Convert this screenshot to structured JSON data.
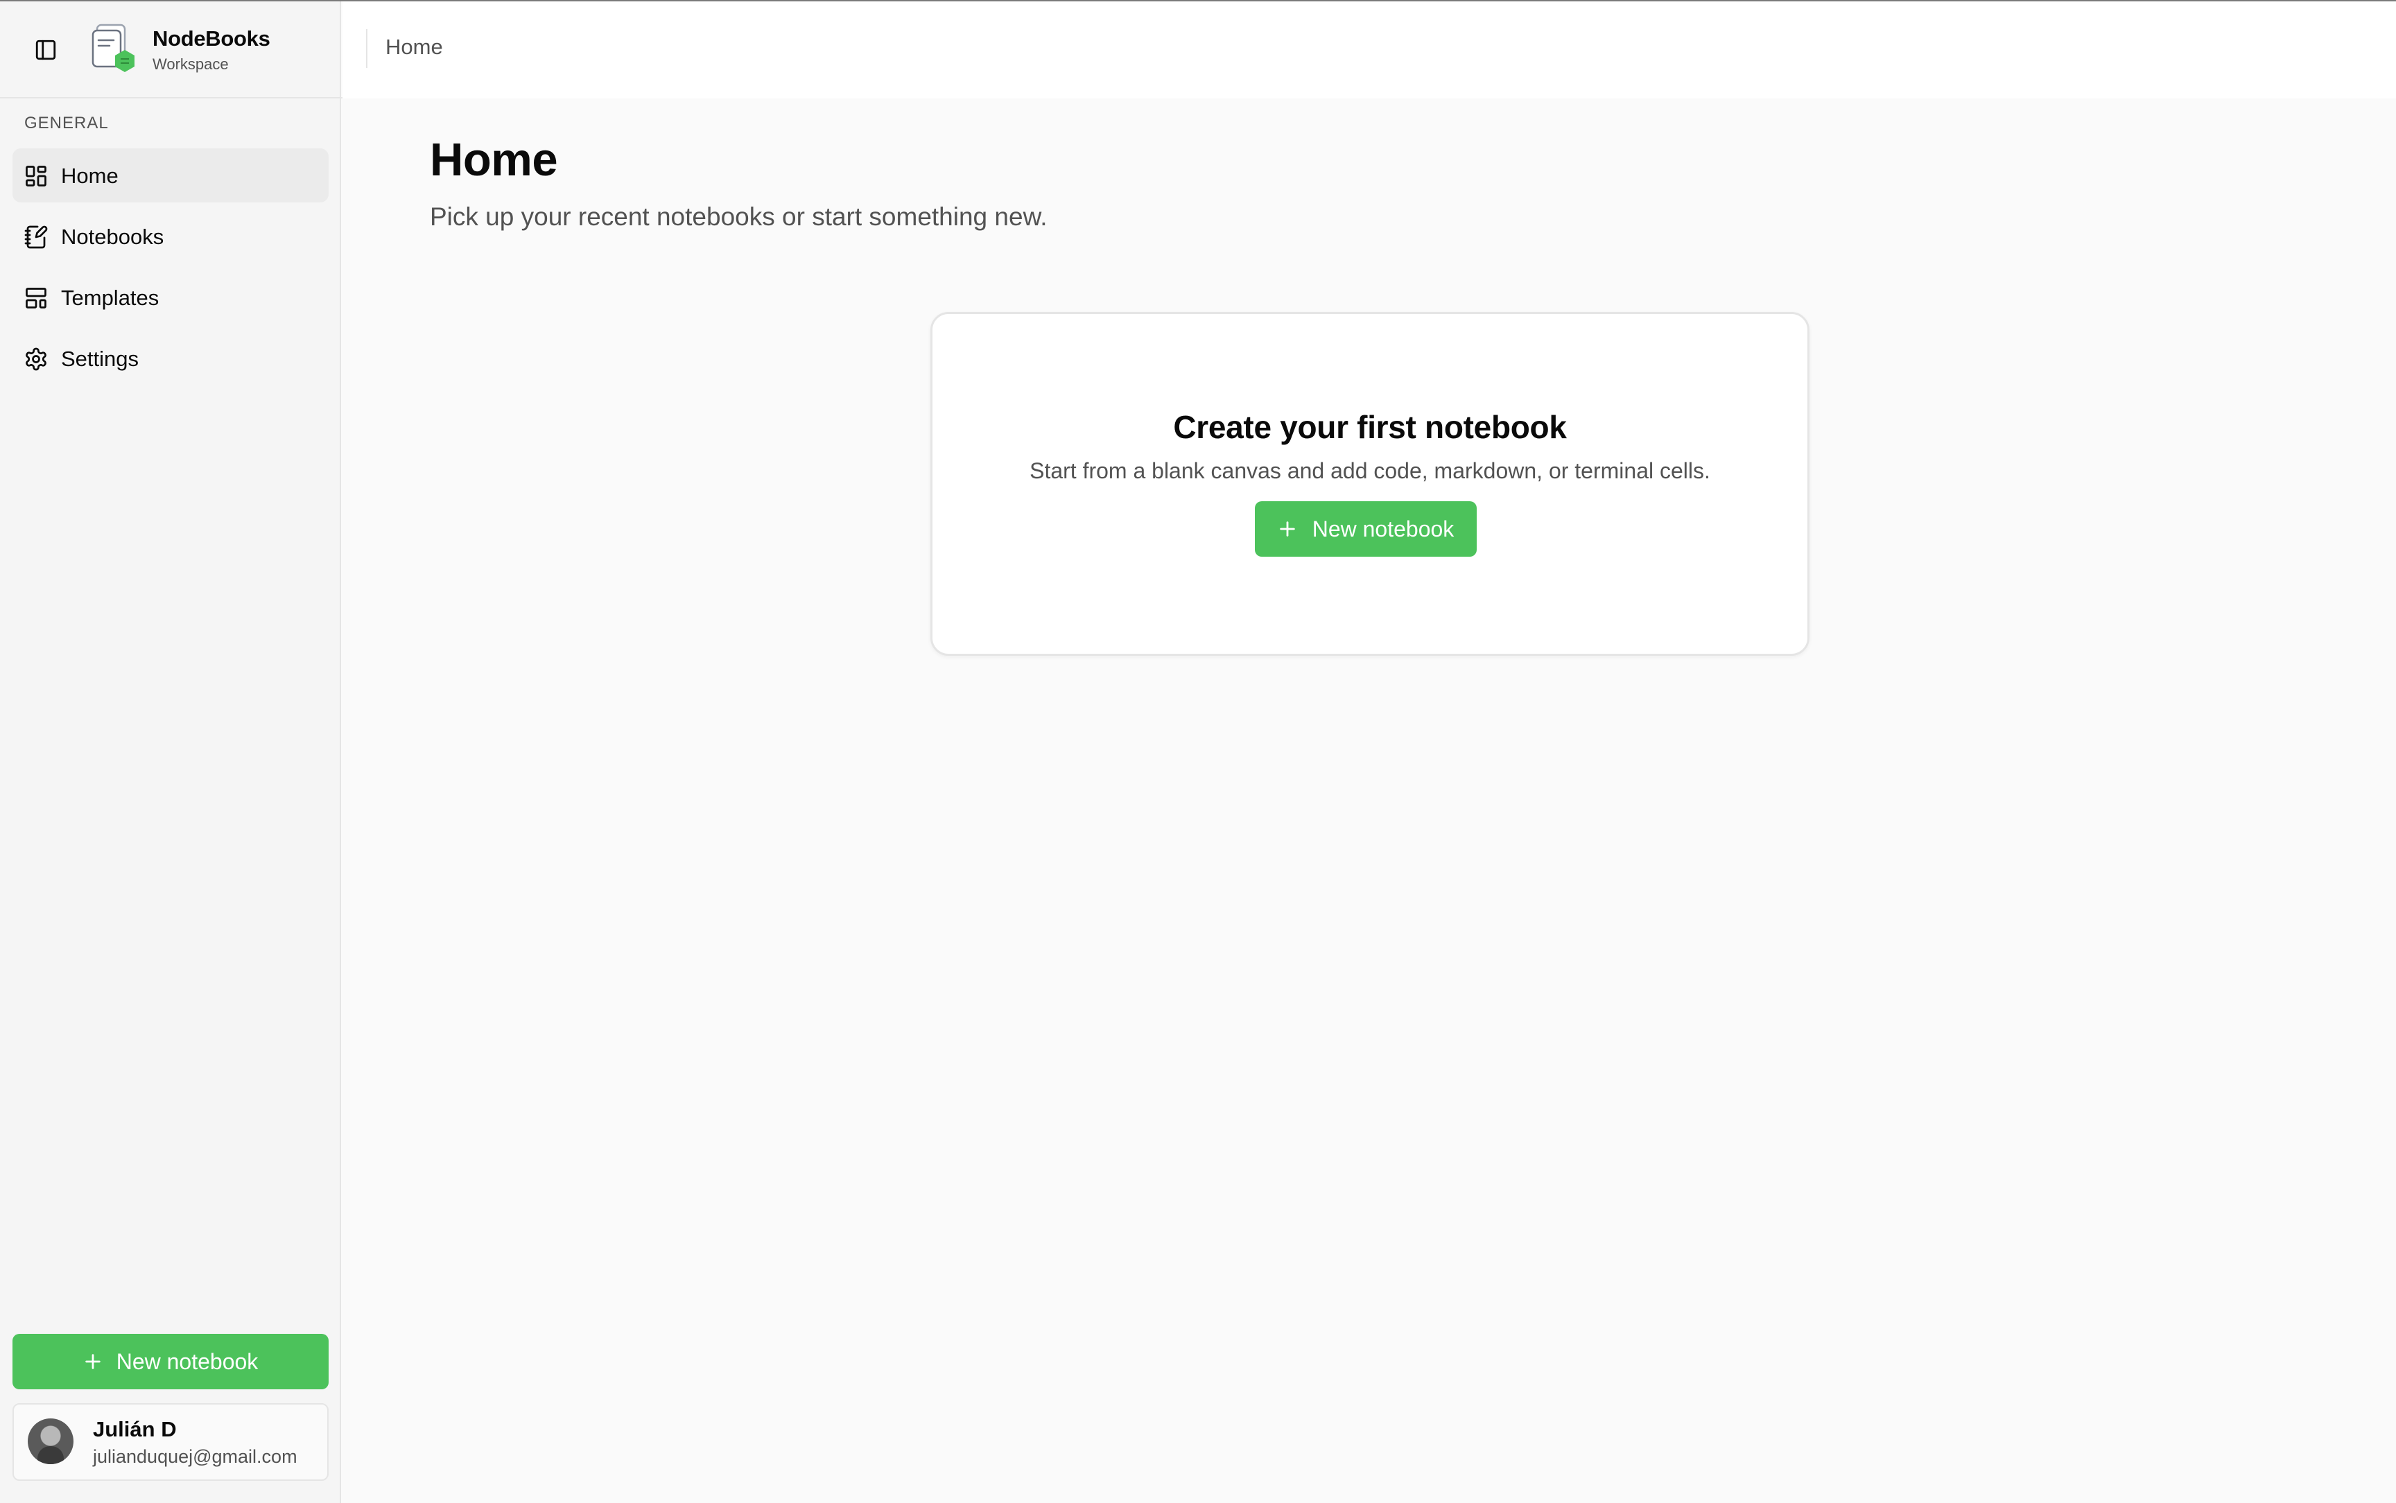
{
  "app": {
    "name": "NodeBooks",
    "workspace_label": "Workspace",
    "accent_color": "#4cc25b"
  },
  "sidebar": {
    "section_label": "GENERAL",
    "items": [
      {
        "label": "Home",
        "icon": "layout-dashboard-icon",
        "active": true
      },
      {
        "label": "Notebooks",
        "icon": "notebook-pen-icon",
        "active": false
      },
      {
        "label": "Templates",
        "icon": "layout-template-icon",
        "active": false
      },
      {
        "label": "Settings",
        "icon": "gear-icon",
        "active": false
      }
    ],
    "new_notebook_label": "New notebook",
    "user": {
      "name": "Julián D",
      "email": "julianduquej@gmail.com"
    }
  },
  "header": {
    "breadcrumb": "Home"
  },
  "main": {
    "title": "Home",
    "subtitle": "Pick up your recent notebooks or start something new.",
    "empty_state": {
      "title": "Create your first notebook",
      "description": "Start from a blank canvas and add code, markdown, or terminal cells.",
      "button_label": "New notebook"
    }
  }
}
